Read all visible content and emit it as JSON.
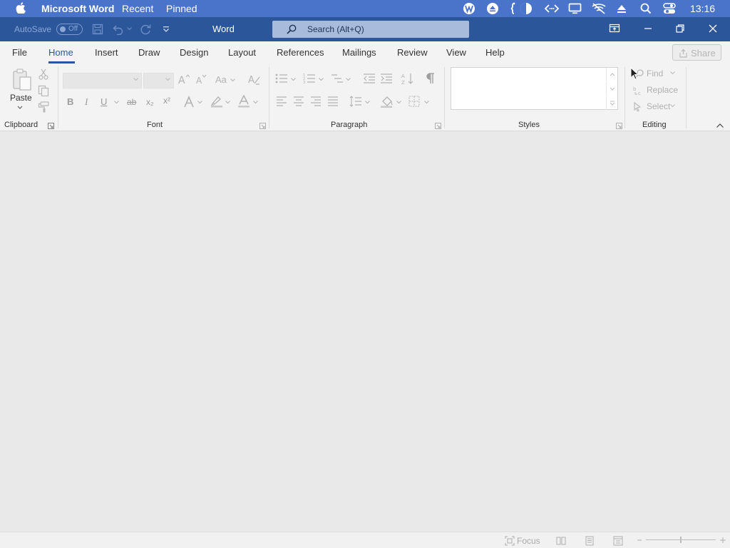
{
  "menubar": {
    "app_name": "Microsoft Word",
    "menus": [
      "Recent",
      "Pinned"
    ],
    "clock": "13:16"
  },
  "titlebar": {
    "autosave_label": "AutoSave",
    "autosave_state": "Off",
    "doc_title": "Word",
    "search_placeholder": "Search (Alt+Q)"
  },
  "tabs": [
    "File",
    "Home",
    "Insert",
    "Draw",
    "Design",
    "Layout",
    "References",
    "Mailings",
    "Review",
    "View",
    "Help"
  ],
  "active_tab": "Home",
  "share_label": "Share",
  "ribbon": {
    "paste_label": "Paste",
    "groups": {
      "clipboard": "Clipboard",
      "font": "Font",
      "paragraph": "Paragraph",
      "styles": "Styles",
      "editing": "Editing"
    },
    "font_buttons": {
      "bold": "B",
      "italic": "I",
      "underline": "U",
      "strikethrough": "ab",
      "subscript": "x₂",
      "superscript": "x²",
      "change_case": "Aa",
      "grow": "A",
      "shrink": "A"
    },
    "editing": {
      "find": "Find",
      "replace": "Replace",
      "select": "Select"
    }
  },
  "statusbar": {
    "focus_label": "Focus"
  },
  "colors": {
    "menubar": "#4a74c9",
    "titlebar": "#2b579a",
    "accent": "#2b579a",
    "ribbon": "#f3f3f3",
    "canvas": "#e9e9e9"
  }
}
